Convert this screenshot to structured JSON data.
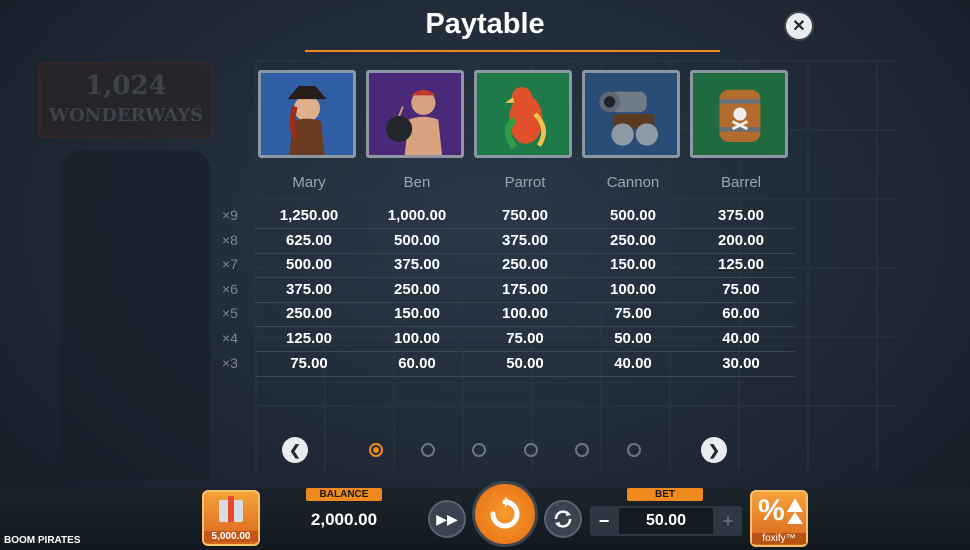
{
  "title": "Paytable",
  "close_icon": "close-icon",
  "background": {
    "logo_line1": "1,024",
    "logo_line2": "WONDERWAYS"
  },
  "symbols": [
    {
      "name": "Mary",
      "bg": "#2f5fa5"
    },
    {
      "name": "Ben",
      "bg": "#4a2a78"
    },
    {
      "name": "Parrot",
      "bg": "#1f7a4a"
    },
    {
      "name": "Cannon",
      "bg": "#2a4d78"
    },
    {
      "name": "Barrel",
      "bg": "#1f6a3f"
    }
  ],
  "rows": [
    {
      "mult": "×9",
      "values": [
        "1,250.00",
        "1,000.00",
        "750.00",
        "500.00",
        "375.00"
      ]
    },
    {
      "mult": "×8",
      "values": [
        "625.00",
        "500.00",
        "375.00",
        "250.00",
        "200.00"
      ]
    },
    {
      "mult": "×7",
      "values": [
        "500.00",
        "375.00",
        "250.00",
        "150.00",
        "125.00"
      ]
    },
    {
      "mult": "×6",
      "values": [
        "375.00",
        "250.00",
        "175.00",
        "100.00",
        "75.00"
      ]
    },
    {
      "mult": "×5",
      "values": [
        "250.00",
        "150.00",
        "100.00",
        "75.00",
        "60.00"
      ]
    },
    {
      "mult": "×4",
      "values": [
        "125.00",
        "100.00",
        "75.00",
        "50.00",
        "40.00"
      ]
    },
    {
      "mult": "×3",
      "values": [
        "75.00",
        "60.00",
        "50.00",
        "40.00",
        "30.00"
      ]
    }
  ],
  "pagination": {
    "pages": 6,
    "active": 0
  },
  "bottom": {
    "game_name": "BOOM PIRATES",
    "gift_amount": "5,000.00",
    "balance_label": "BALANCE",
    "balance_value": "2,000.00",
    "bet_label": "BET",
    "bet_value": "50.00",
    "bet_minus": "−",
    "bet_plus": "+",
    "foxify_label": "foxify™",
    "accent": "#f08a1f"
  }
}
